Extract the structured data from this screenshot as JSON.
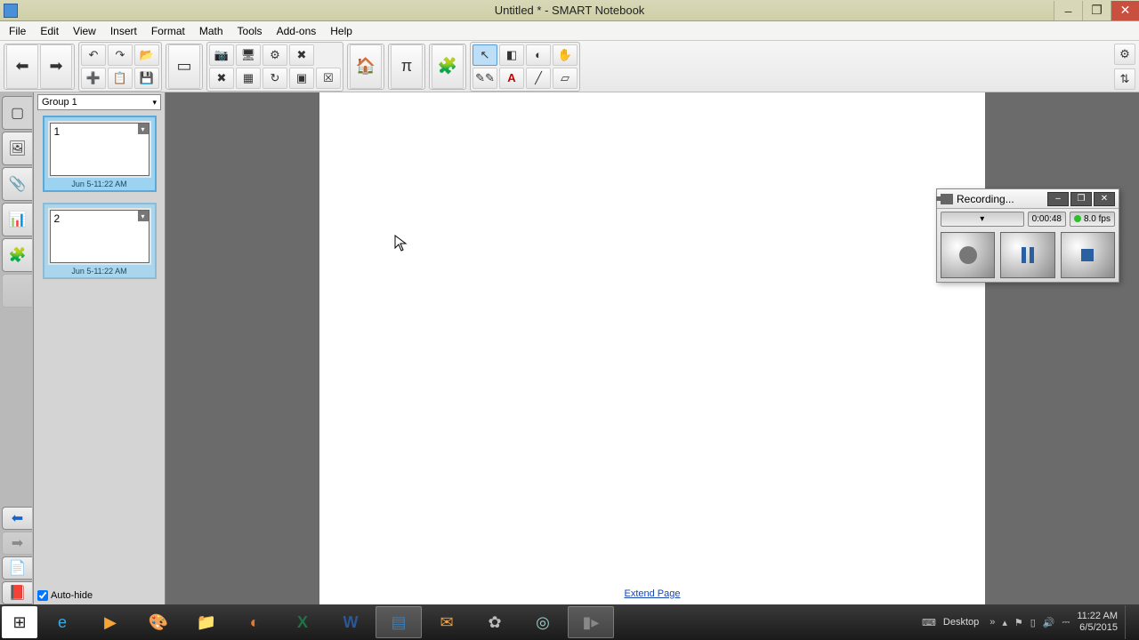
{
  "window": {
    "title": "Untitled * - SMART Notebook",
    "minimize": "–",
    "maximize": "❐",
    "close": "✕"
  },
  "menu": [
    "File",
    "Edit",
    "View",
    "Insert",
    "Format",
    "Math",
    "Tools",
    "Add-ons",
    "Help"
  ],
  "toolbar": {
    "prev": "prev-page",
    "next": "next-page",
    "undo": "undo",
    "redo": "redo",
    "open": "open",
    "save": "save"
  },
  "sidebar": {
    "group_label": "Group 1",
    "thumbs": [
      {
        "num": "1",
        "time": "Jun 5-11:22 AM"
      },
      {
        "num": "2",
        "time": "Jun 5-11:22 AM"
      }
    ],
    "autohide_label": "Auto-hide",
    "autohide_checked": true
  },
  "canvas": {
    "extend_label": "Extend Page"
  },
  "recorder": {
    "title": "Recording...",
    "time": "0:00:48",
    "fps": "8.0 fps",
    "minimize": "–",
    "maximize": "❐",
    "close": "✕"
  },
  "taskbar": {
    "desktop_label": "Desktop",
    "time": "11:22 AM",
    "date": "6/5/2015"
  }
}
